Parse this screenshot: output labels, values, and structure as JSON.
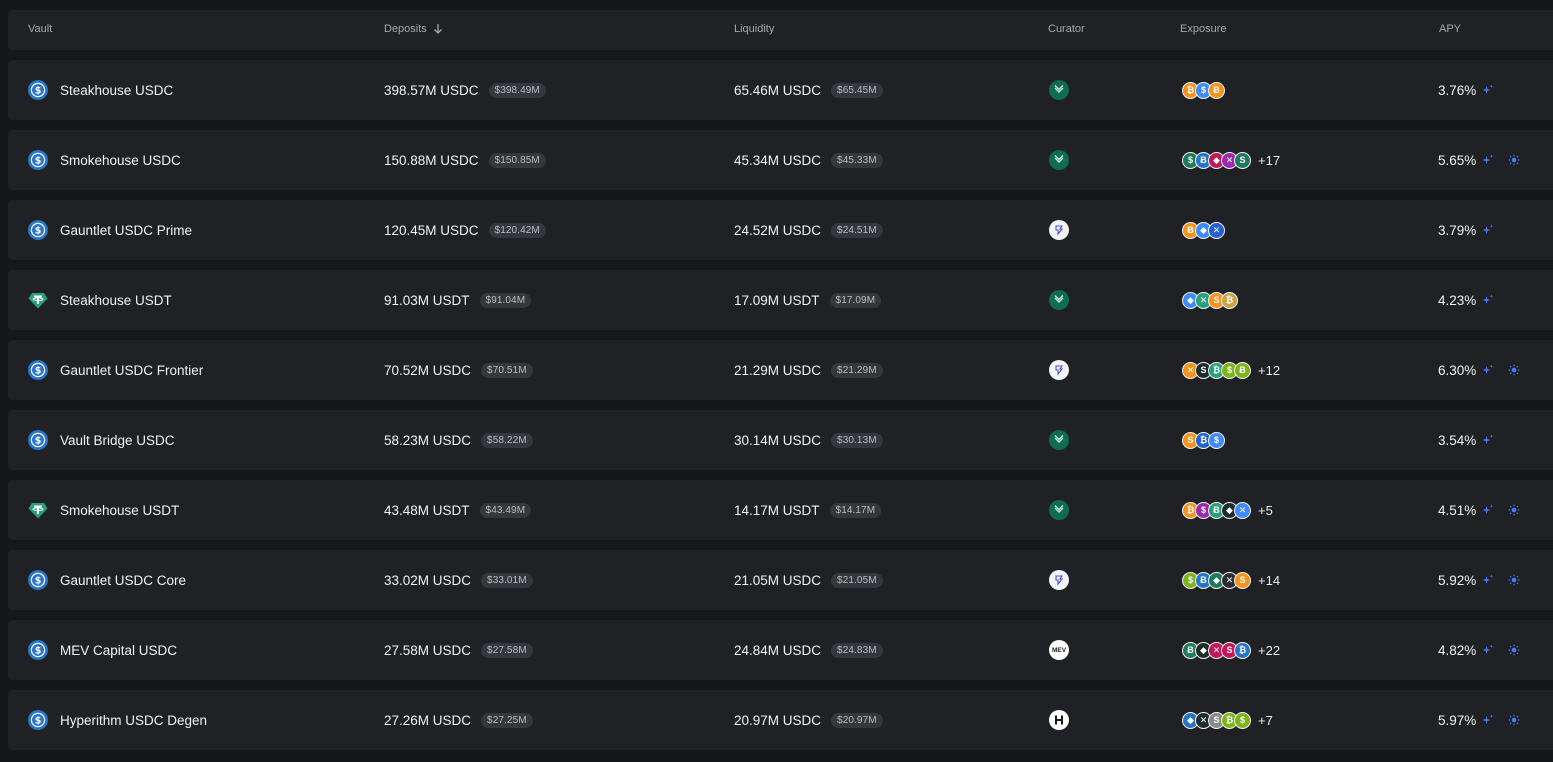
{
  "header": {
    "vault": "Vault",
    "deposits": "Deposits",
    "liquidity": "Liquidity",
    "curator": "Curator",
    "exposure": "Exposure",
    "apy": "APY"
  },
  "icons": {
    "usdc": "usdc-token-icon",
    "usdt": "usdt-token-icon",
    "sort": "arrow-down-icon",
    "rewards": "sparkle-icon",
    "points": "sun-icon"
  },
  "colors": {
    "background": "#15171a",
    "row": "#1f2125",
    "usdc": "#2775ca",
    "usdt": "#26a17b",
    "steakhouse": "#0f6b52",
    "accent": "#4a7bff"
  },
  "rows": [
    {
      "token": "usdc",
      "name": "Steakhouse USDC",
      "deposits": "398.57M USDC",
      "deposits_usd": "$398.49M",
      "liquidity": "65.46M USDC",
      "liquidity_usd": "$65.45M",
      "curator": "steakhouse",
      "exposure": [
        "#f7931a",
        "#3d8bfd",
        "#f7931a"
      ],
      "more": "",
      "apy": "3.76%",
      "sun": false
    },
    {
      "token": "usdc",
      "name": "Smokehouse USDC",
      "deposits": "150.88M USDC",
      "deposits_usd": "$150.85M",
      "liquidity": "45.34M USDC",
      "liquidity_usd": "$45.33M",
      "curator": "steakhouse",
      "exposure": [
        "#1d7a5a",
        "#2775ca",
        "#c2185b",
        "#9c27b0",
        "#1d7a5a"
      ],
      "more": "+17",
      "apy": "5.65%",
      "sun": true
    },
    {
      "token": "usdc",
      "name": "Gauntlet USDC Prime",
      "deposits": "120.45M USDC",
      "deposits_usd": "$120.42M",
      "liquidity": "24.52M USDC",
      "liquidity_usd": "$24.51M",
      "curator": "gauntlet",
      "exposure": [
        "#f7931a",
        "#3d8bfd",
        "#2062d0"
      ],
      "more": "",
      "apy": "3.79%",
      "sun": false
    },
    {
      "token": "usdt",
      "name": "Steakhouse USDT",
      "deposits": "91.03M USDT",
      "deposits_usd": "$91.04M",
      "liquidity": "17.09M USDT",
      "liquidity_usd": "$17.09M",
      "curator": "steakhouse",
      "exposure": [
        "#3d8bfd",
        "#26a17b",
        "#f7931a",
        "#c9a44a"
      ],
      "more": "",
      "apy": "4.23%",
      "sun": false
    },
    {
      "token": "usdc",
      "name": "Gauntlet USDC Frontier",
      "deposits": "70.52M USDC",
      "deposits_usd": "$70.51M",
      "liquidity": "21.29M USDC",
      "liquidity_usd": "$21.29M",
      "curator": "gauntlet",
      "exposure": [
        "#f7931a",
        "#1f2d2a",
        "#26a17b",
        "#7cb518",
        "#7cb518"
      ],
      "more": "+12",
      "apy": "6.30%",
      "sun": true
    },
    {
      "token": "usdc",
      "name": "Vault Bridge USDC",
      "deposits": "58.23M USDC",
      "deposits_usd": "$58.22M",
      "liquidity": "30.14M USDC",
      "liquidity_usd": "$30.13M",
      "curator": "steakhouse",
      "exposure": [
        "#f7931a",
        "#2062d0",
        "#3d8bfd"
      ],
      "more": "",
      "apy": "3.54%",
      "sun": false
    },
    {
      "token": "usdt",
      "name": "Smokehouse USDT",
      "deposits": "43.48M USDT",
      "deposits_usd": "$43.49M",
      "liquidity": "14.17M USDT",
      "liquidity_usd": "$14.17M",
      "curator": "steakhouse",
      "exposure": [
        "#f7931a",
        "#9c27b0",
        "#26a17b",
        "#1f2d2a",
        "#3d8bfd"
      ],
      "more": "+5",
      "apy": "4.51%",
      "sun": true
    },
    {
      "token": "usdc",
      "name": "Gauntlet USDC Core",
      "deposits": "33.02M USDC",
      "deposits_usd": "$33.01M",
      "liquidity": "21.05M USDC",
      "liquidity_usd": "$21.05M",
      "curator": "gauntlet",
      "exposure": [
        "#7cb518",
        "#2775ca",
        "#1d7a5a",
        "#2a2d33",
        "#f7931a"
      ],
      "more": "+14",
      "apy": "5.92%",
      "sun": true
    },
    {
      "token": "usdc",
      "name": "MEV Capital USDC",
      "deposits": "27.58M USDC",
      "deposits_usd": "$27.58M",
      "liquidity": "24.84M USDC",
      "liquidity_usd": "$24.83M",
      "curator": "mev",
      "exposure": [
        "#1d7a5a",
        "#1f2d2a",
        "#c2185b",
        "#c2185b",
        "#2775ca"
      ],
      "more": "+22",
      "apy": "4.82%",
      "sun": true
    },
    {
      "token": "usdc",
      "name": "Hyperithm USDC Degen",
      "deposits": "27.26M USDC",
      "deposits_usd": "$27.25M",
      "liquidity": "20.97M USDC",
      "liquidity_usd": "$20.97M",
      "curator": "hyperithm",
      "exposure": [
        "#2775ca",
        "#1f2d2a",
        "#8a8a8a",
        "#7cb518",
        "#7cb518"
      ],
      "more": "+7",
      "apy": "5.97%",
      "sun": true
    }
  ]
}
